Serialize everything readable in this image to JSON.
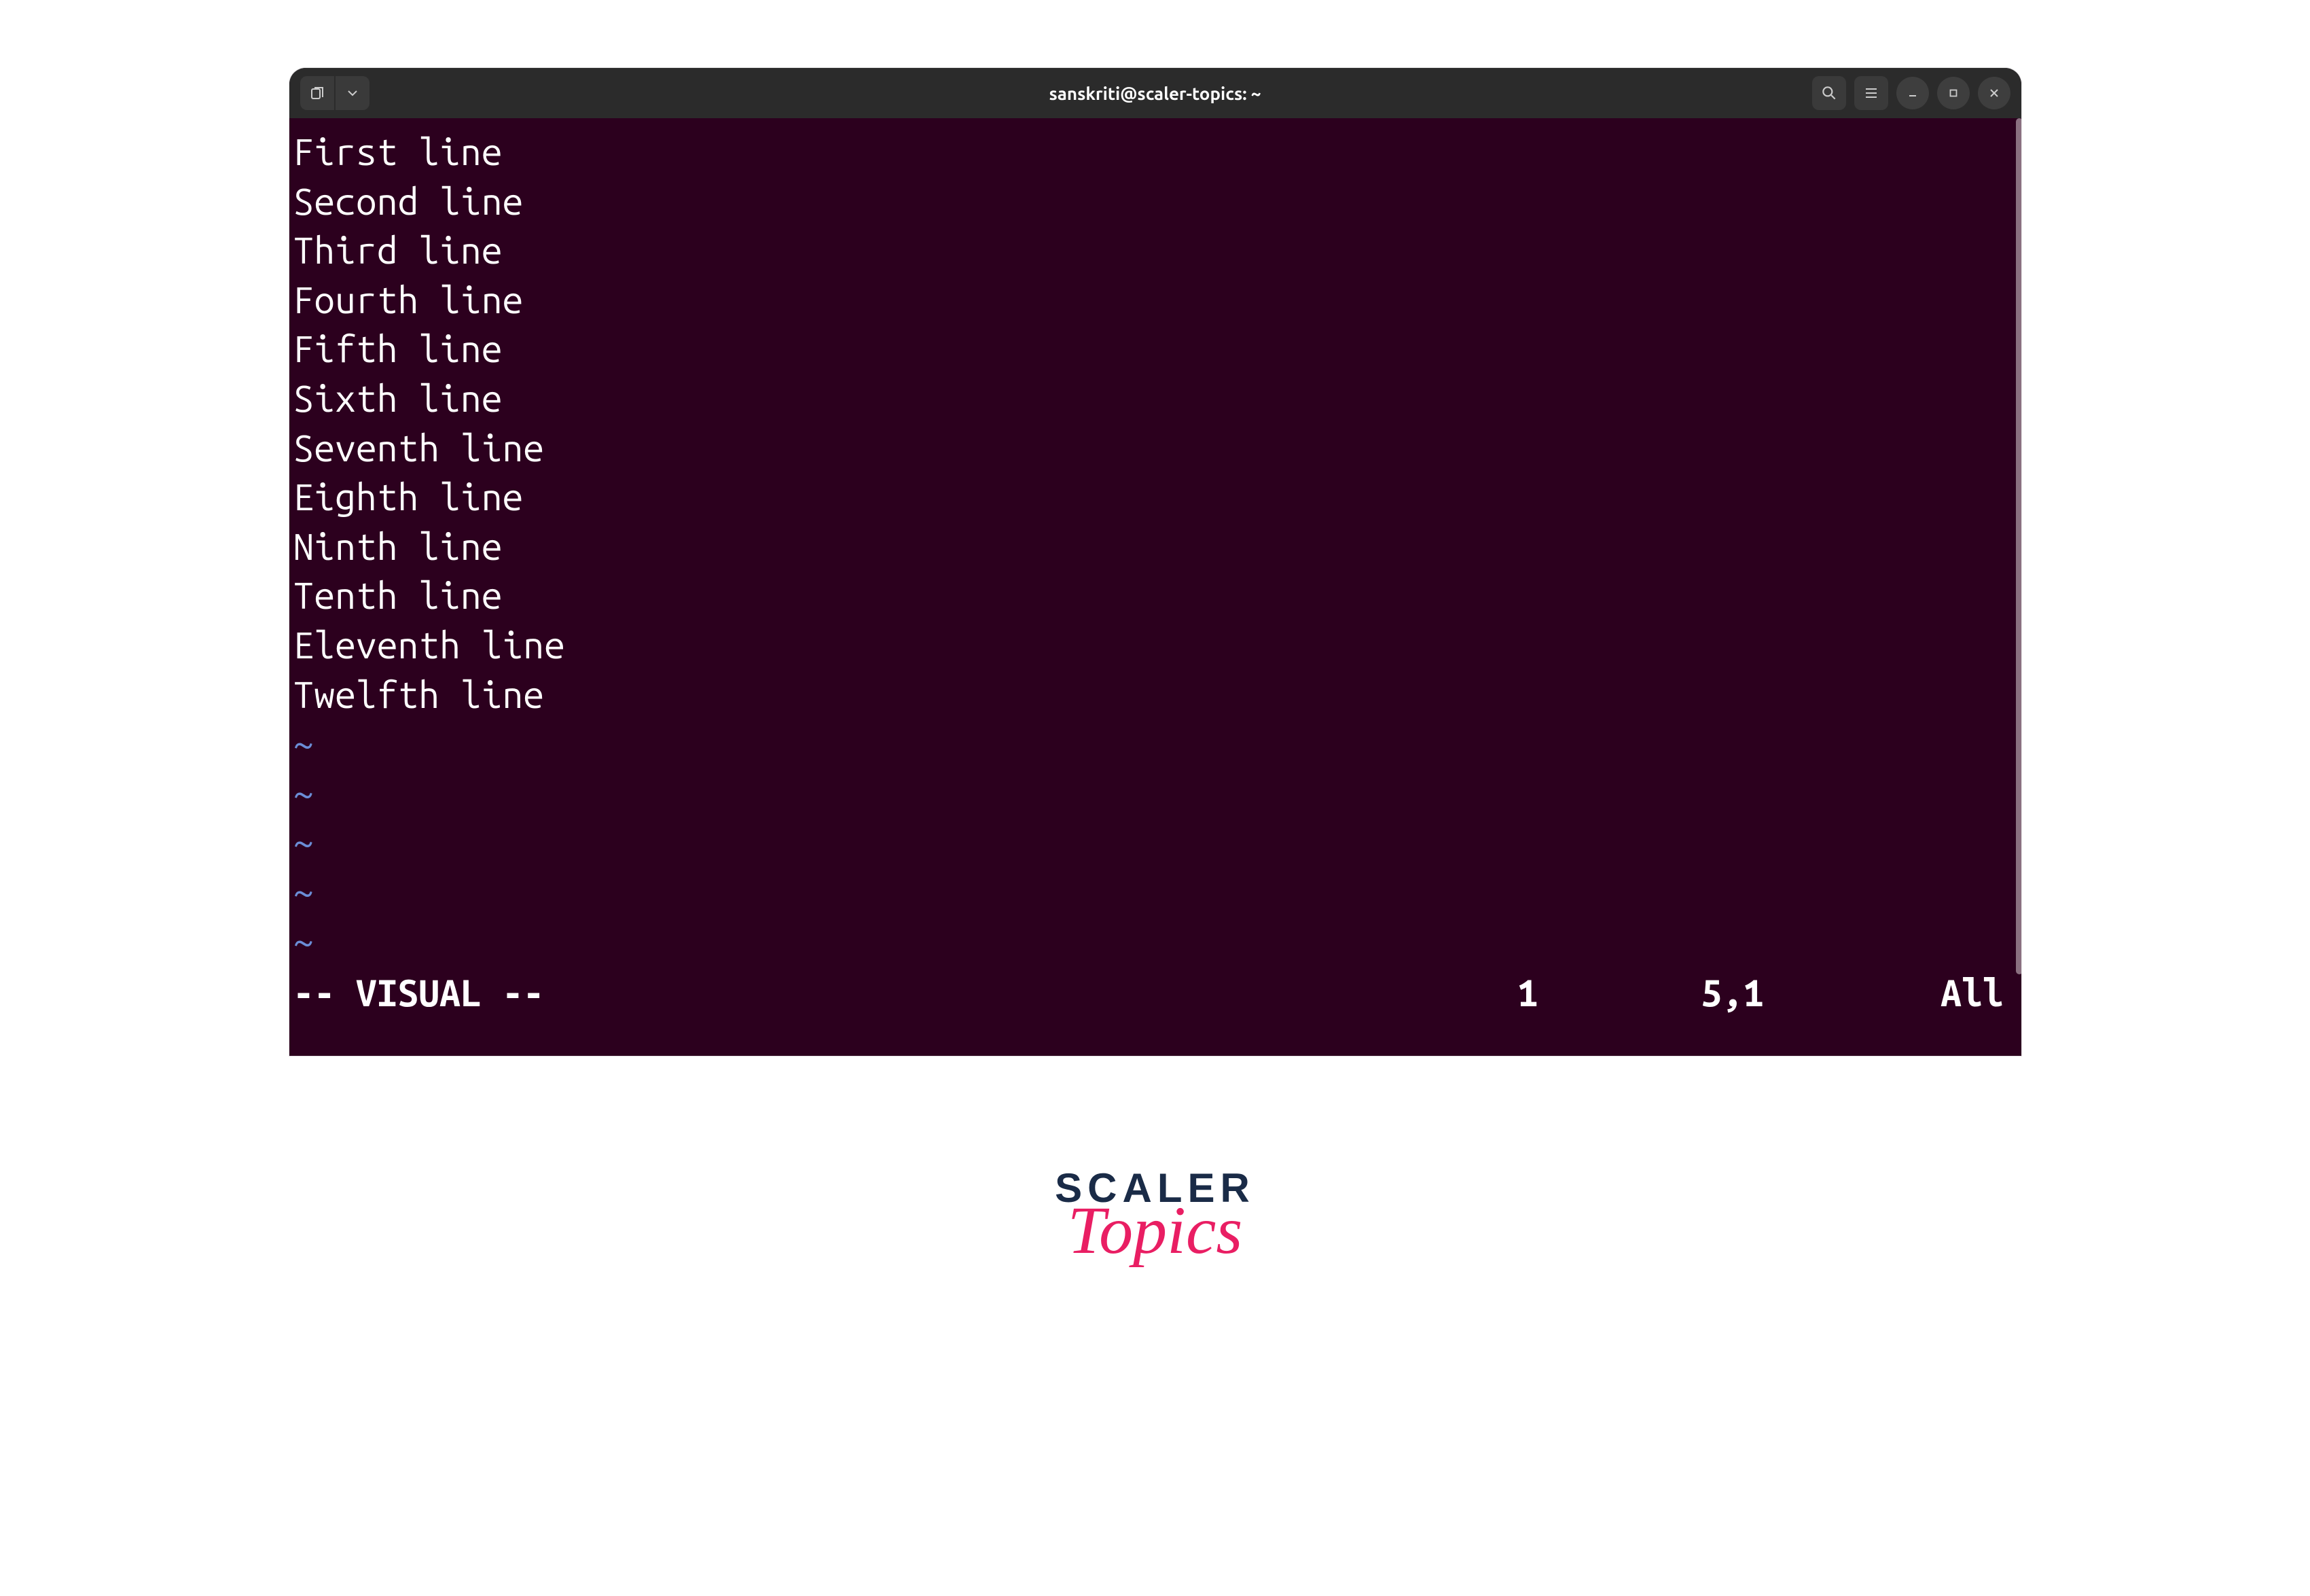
{
  "titlebar": {
    "title": "sanskriti@scaler-topics: ~"
  },
  "editor": {
    "lines": [
      "First line",
      "Second line",
      "Third line",
      "Fourth line",
      "Fifth line",
      "Sixth line",
      "Seventh line",
      "Eighth line",
      "Ninth line",
      "Tenth line",
      "Eleventh line",
      "Twelfth line"
    ],
    "tilde_count": 5
  },
  "status": {
    "mode": "-- VISUAL --",
    "num1": "1",
    "position": "5,1",
    "view": "All"
  },
  "logo": {
    "scaler": "SCALER",
    "topics": "Topics"
  }
}
